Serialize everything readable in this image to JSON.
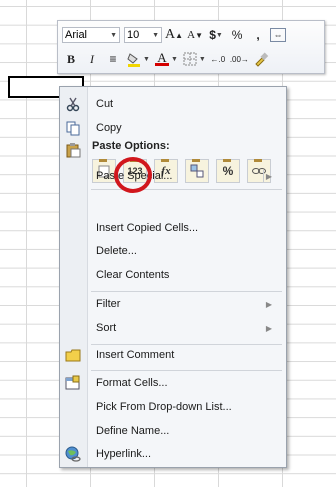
{
  "mini_toolbar": {
    "font_name": "Arial",
    "font_size": "10",
    "row1_buttons": [
      {
        "name": "increase-font-size-button",
        "glyph": "A"
      },
      {
        "name": "decrease-font-size-button",
        "glyph": "A"
      },
      {
        "name": "accounting-format-button",
        "glyph": "$"
      },
      {
        "name": "percent-style-button",
        "glyph": "%"
      },
      {
        "name": "comma-style-button",
        "glyph": ","
      }
    ],
    "row2_buttons": [
      {
        "name": "bold-button",
        "glyph": "B"
      },
      {
        "name": "italic-button",
        "glyph": "I"
      },
      {
        "name": "center-align-button",
        "glyph": "≡"
      },
      {
        "name": "fill-color-button",
        "glyph": "◆"
      },
      {
        "name": "font-color-button",
        "glyph": "A"
      },
      {
        "name": "borders-button",
        "glyph": "▦"
      },
      {
        "name": "increase-decimal-button",
        "glyph": ".00"
      },
      {
        "name": "decrease-decimal-button",
        "glyph": ".0"
      },
      {
        "name": "format-painter-button",
        "glyph": "✎"
      }
    ],
    "colors": {
      "fill": "#f2d600",
      "font": "#d40000"
    }
  },
  "menu": {
    "cut": "Cut",
    "copy": "Copy",
    "paste_options_header": "Paste Options:",
    "paste_buttons": [
      {
        "name": "paste-button",
        "label": ""
      },
      {
        "name": "paste-values-button",
        "label": "123"
      },
      {
        "name": "paste-formulas-button",
        "label": "fx"
      },
      {
        "name": "paste-transpose-button",
        "label": ""
      },
      {
        "name": "paste-formatting-button",
        "label": "%"
      },
      {
        "name": "paste-link-button",
        "label": ""
      }
    ],
    "paste_special": "Paste Special...",
    "insert_copied_cells": "Insert Copied Cells...",
    "delete": "Delete...",
    "clear_contents": "Clear Contents",
    "filter": "Filter",
    "sort": "Sort",
    "insert_comment": "Insert Comment",
    "format_cells": "Format Cells...",
    "pick_from_list": "Pick From Drop-down List...",
    "define_name": "Define Name...",
    "hyperlink": "Hyperlink..."
  },
  "highlight_color": "#d1171d"
}
